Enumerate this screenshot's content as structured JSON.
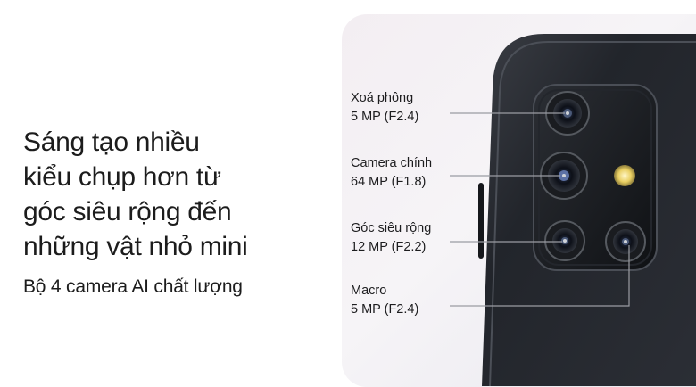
{
  "headline": {
    "line1": "Sáng tạo nhiều",
    "line2": "kiểu chụp hơn từ",
    "line3": "góc siêu rộng đến",
    "line4": "những vật nhỏ mini"
  },
  "subheadline": "Bộ 4 camera AI chất lượng",
  "cameras": [
    {
      "name": "Xoá phông",
      "spec": "5 MP (F2.4)"
    },
    {
      "name": "Camera chính",
      "spec": "64 MP (F1.8)"
    },
    {
      "name": "Góc siêu rộng",
      "spec": "12 MP (F2.2)"
    },
    {
      "name": "Macro",
      "spec": "5 MP (F2.4)"
    }
  ],
  "colors": {
    "phone_body": "#1f2228",
    "camera_module": "#15171b",
    "leader_line": "#8a8d93",
    "flash": "#f2dc7a"
  }
}
